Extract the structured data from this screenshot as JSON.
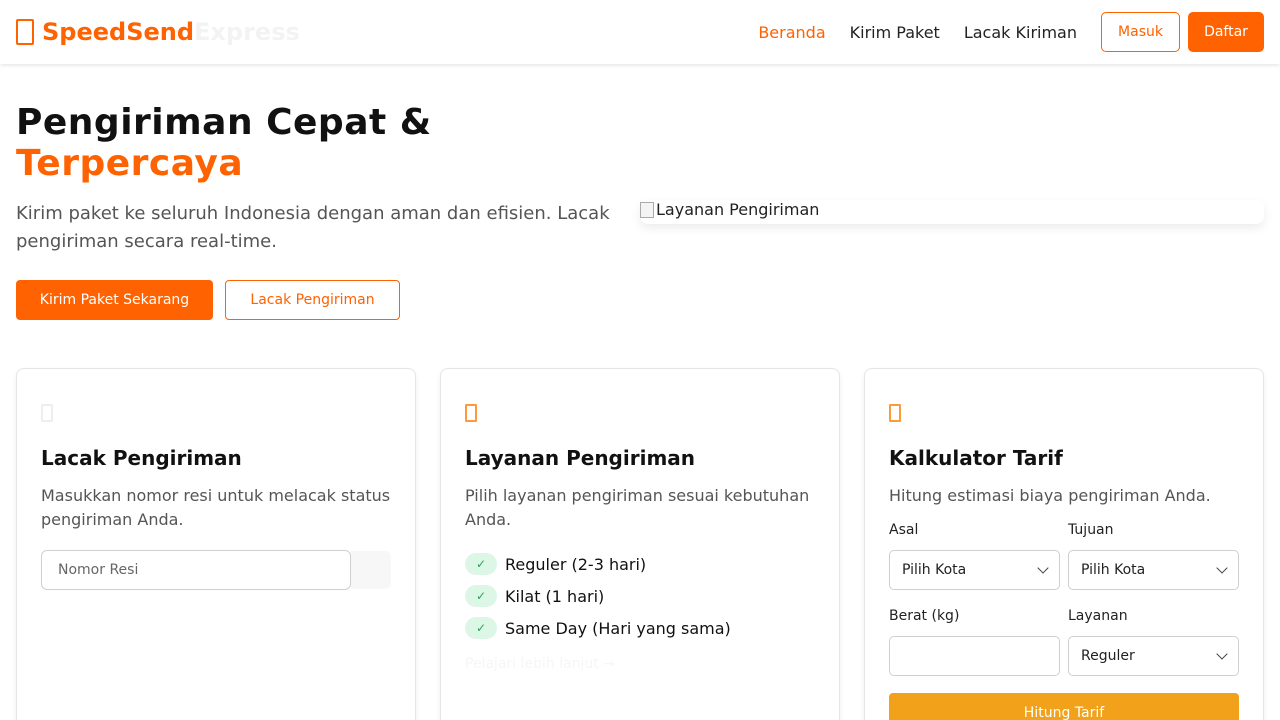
{
  "brand": {
    "name_primary": "SpeedSend",
    "name_secondary": "Express",
    "icon": "box-icon",
    "accent": "#ff6200"
  },
  "nav": {
    "links": [
      "Beranda",
      "Kirim Paket",
      "Lacak Kiriman"
    ],
    "login": "Masuk",
    "register": "Daftar"
  },
  "hero": {
    "title_line1": "Pengiriman Cepat &",
    "title_line2": "Terpercaya",
    "description": "Kirim paket ke seluruh Indonesia dengan aman dan efisien. Lacak pengiriman secara real-time.",
    "primary_button": "Kirim Paket Sekarang",
    "secondary_button": "Lacak Pengiriman",
    "image_alt": "Layanan Pengiriman"
  },
  "cards": {
    "track": {
      "title": "Lacak Pengiriman",
      "description": "Masukkan nomor resi untuk melacak status pengiriman Anda.",
      "input_placeholder": "Nomor Resi"
    },
    "services": {
      "title": "Layanan Pengiriman",
      "description": "Pilih layanan pengiriman sesuai kebutuhan Anda.",
      "items": [
        "Reguler (2-3 hari)",
        "Kilat (1 hari)",
        "Same Day (Hari yang sama)"
      ],
      "link": "Pelajari lebih lanjut →"
    },
    "calculator": {
      "title": "Kalkulator Tarif",
      "description": "Hitung estimasi biaya pengiriman Anda.",
      "origin_label": "Asal",
      "origin_value": "Pilih Kota",
      "destination_label": "Tujuan",
      "destination_value": "Pilih Kota",
      "weight_label": "Berat (kg)",
      "weight_value": "",
      "service_label": "Layanan",
      "service_value": "Reguler",
      "button": "Hitung Tarif"
    }
  }
}
